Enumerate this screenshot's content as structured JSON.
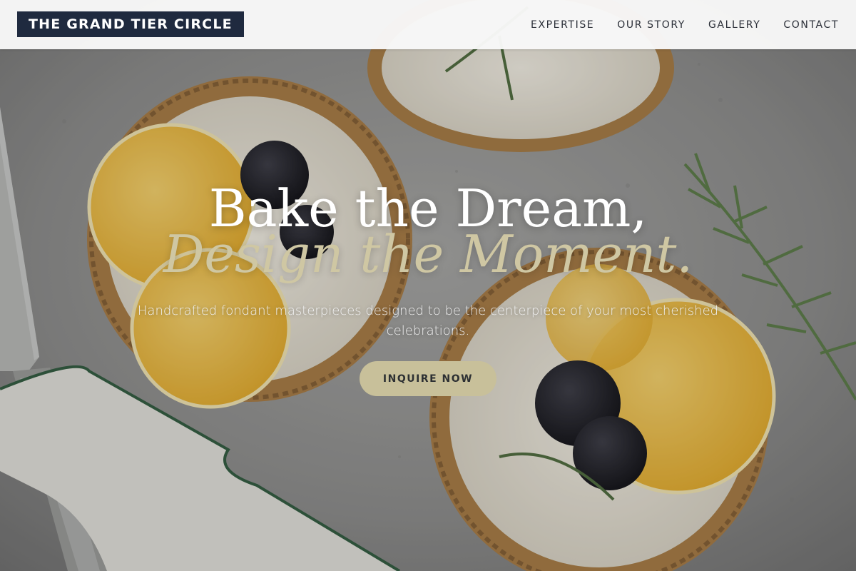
{
  "header": {
    "logo_text": "THE GRAND TIER CIRCLE",
    "nav": [
      {
        "label": "EXPERTISE"
      },
      {
        "label": "OUR STORY"
      },
      {
        "label": "GALLERY"
      },
      {
        "label": "CONTACT"
      }
    ]
  },
  "hero": {
    "headline_line1": "Bake the Dream,",
    "headline_line2": "Design the Moment.",
    "subtext": "Handcrafted fondant masterpieces designed to be the centerpiece of your most cherished celebrations.",
    "cta_label": "INQUIRE NOW",
    "background_image": "tarts-with-orange-blackberries-rosemary"
  },
  "colors": {
    "logo_bg": "#1f2a3f",
    "accent_gold": "#c8c09a",
    "headline_italic": "#cfc7a3",
    "nav_text": "#2b2f38",
    "header_bg": "#f8f8f8"
  }
}
